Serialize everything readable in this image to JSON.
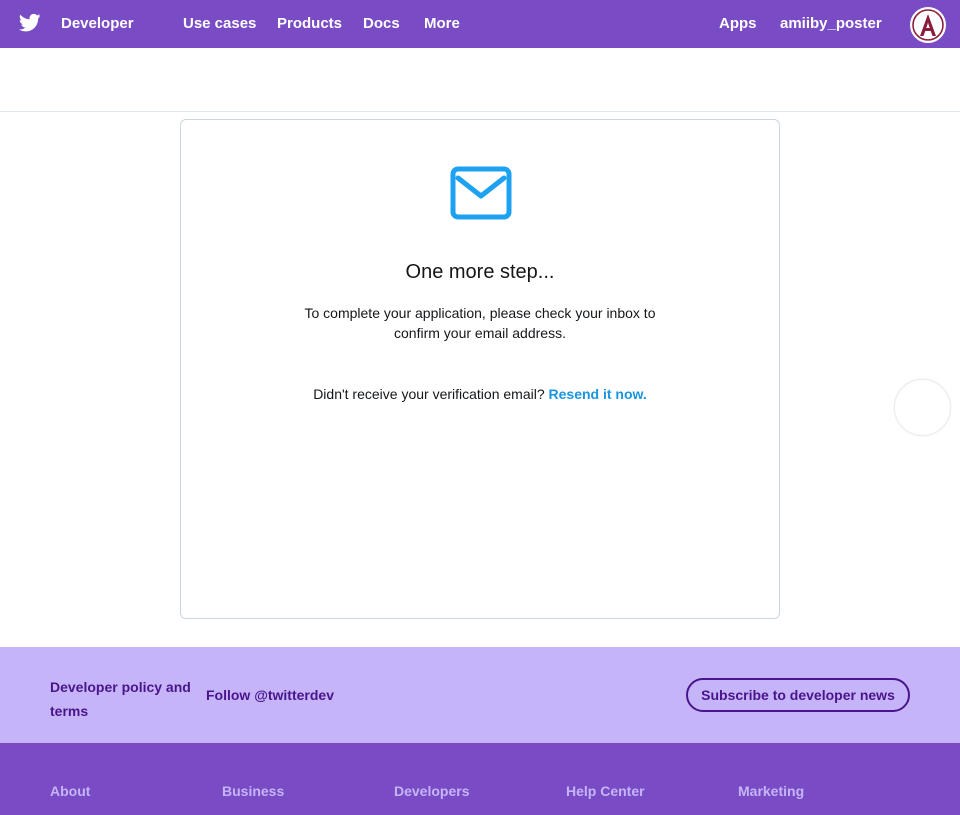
{
  "nav": {
    "brand": "Developer",
    "links": [
      "Use cases",
      "Products",
      "Docs",
      "More"
    ],
    "apps": "Apps",
    "username": "amiiby_poster"
  },
  "card": {
    "icon": "mail-icon",
    "title": "One more step...",
    "message": "To complete your application, please check your inbox to confirm your email address.",
    "resend_prompt": "Didn't receive your verification email?",
    "resend_link": "Resend it now."
  },
  "footer": {
    "policy": "Developer policy and terms",
    "follow": "Follow @twitterdev",
    "subscribe": "Subscribe to developer news",
    "columns": [
      "About",
      "Business",
      "Developers",
      "Help Center",
      "Marketing"
    ]
  },
  "colors": {
    "nav_bg": "#794bc4",
    "footer_band": "#c5b5f8",
    "link": "#1b95e0",
    "mail_icon": "#1da1f2"
  }
}
